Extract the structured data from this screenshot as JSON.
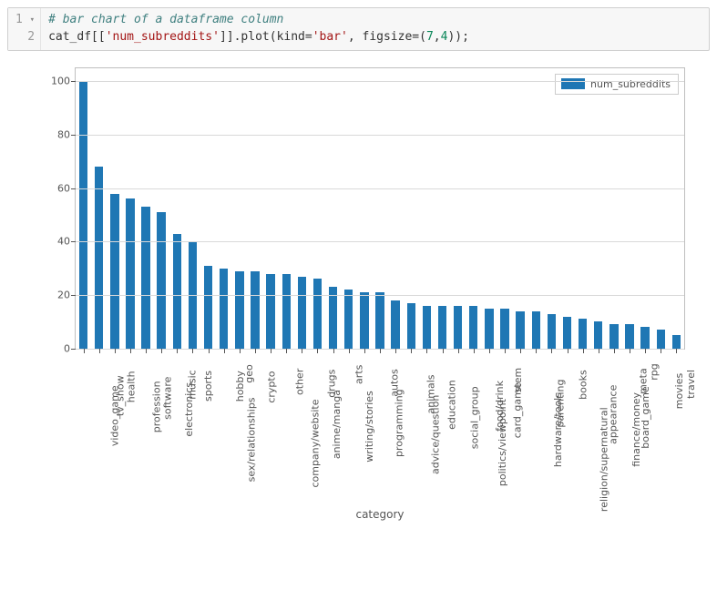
{
  "code": {
    "line1_num": "1",
    "line2_num": "2",
    "run_arrow": "▾",
    "comment": "# bar chart of a dataframe column",
    "ident": "cat_df",
    "open_idx": "[[",
    "col_str": "'num_subreddits'",
    "close_idx": "]]",
    "dot_plot": ".plot",
    "lparen": "(",
    "kw_kind": "kind=",
    "kind_val": "'bar'",
    "comma1": ", ",
    "kw_figsize": "figsize=(",
    "fig_w": "7",
    "fig_comma": ",",
    "fig_h": "4",
    "rparen_close": "));"
  },
  "chart_data": {
    "type": "bar",
    "title": "",
    "xlabel": "category",
    "ylabel": "",
    "ylim": [
      0,
      105
    ],
    "yticks": [
      0,
      20,
      40,
      60,
      80,
      100
    ],
    "legend": [
      "num_subreddits"
    ],
    "bar_color": "#1f77b4",
    "categories": [
      "video_game",
      "tv_show",
      "health",
      "profession",
      "software",
      "electronics",
      "music",
      "sports",
      "sex/relationships",
      "hobby",
      "geo",
      "crypto",
      "company/website",
      "other",
      "anime/manga",
      "drugs",
      "writing/stories",
      "arts",
      "programming",
      "autos",
      "advice/question",
      "animals",
      "education",
      "social_group",
      "politics/viewpoint",
      "food/drink",
      "card_game",
      "stem",
      "hardware/tools",
      "parenting",
      "religion/supernatural",
      "books",
      "appearance",
      "finance/money",
      "board_game",
      "meta",
      "rpg",
      "movies",
      "travel"
    ],
    "values": [
      100,
      68,
      58,
      56,
      53,
      51,
      43,
      40,
      31,
      30,
      29,
      29,
      28,
      28,
      27,
      26,
      23,
      22,
      21,
      21,
      18,
      17,
      16,
      16,
      16,
      16,
      15,
      15,
      14,
      14,
      13,
      12,
      11,
      10,
      9,
      9,
      8,
      7,
      5
    ]
  }
}
